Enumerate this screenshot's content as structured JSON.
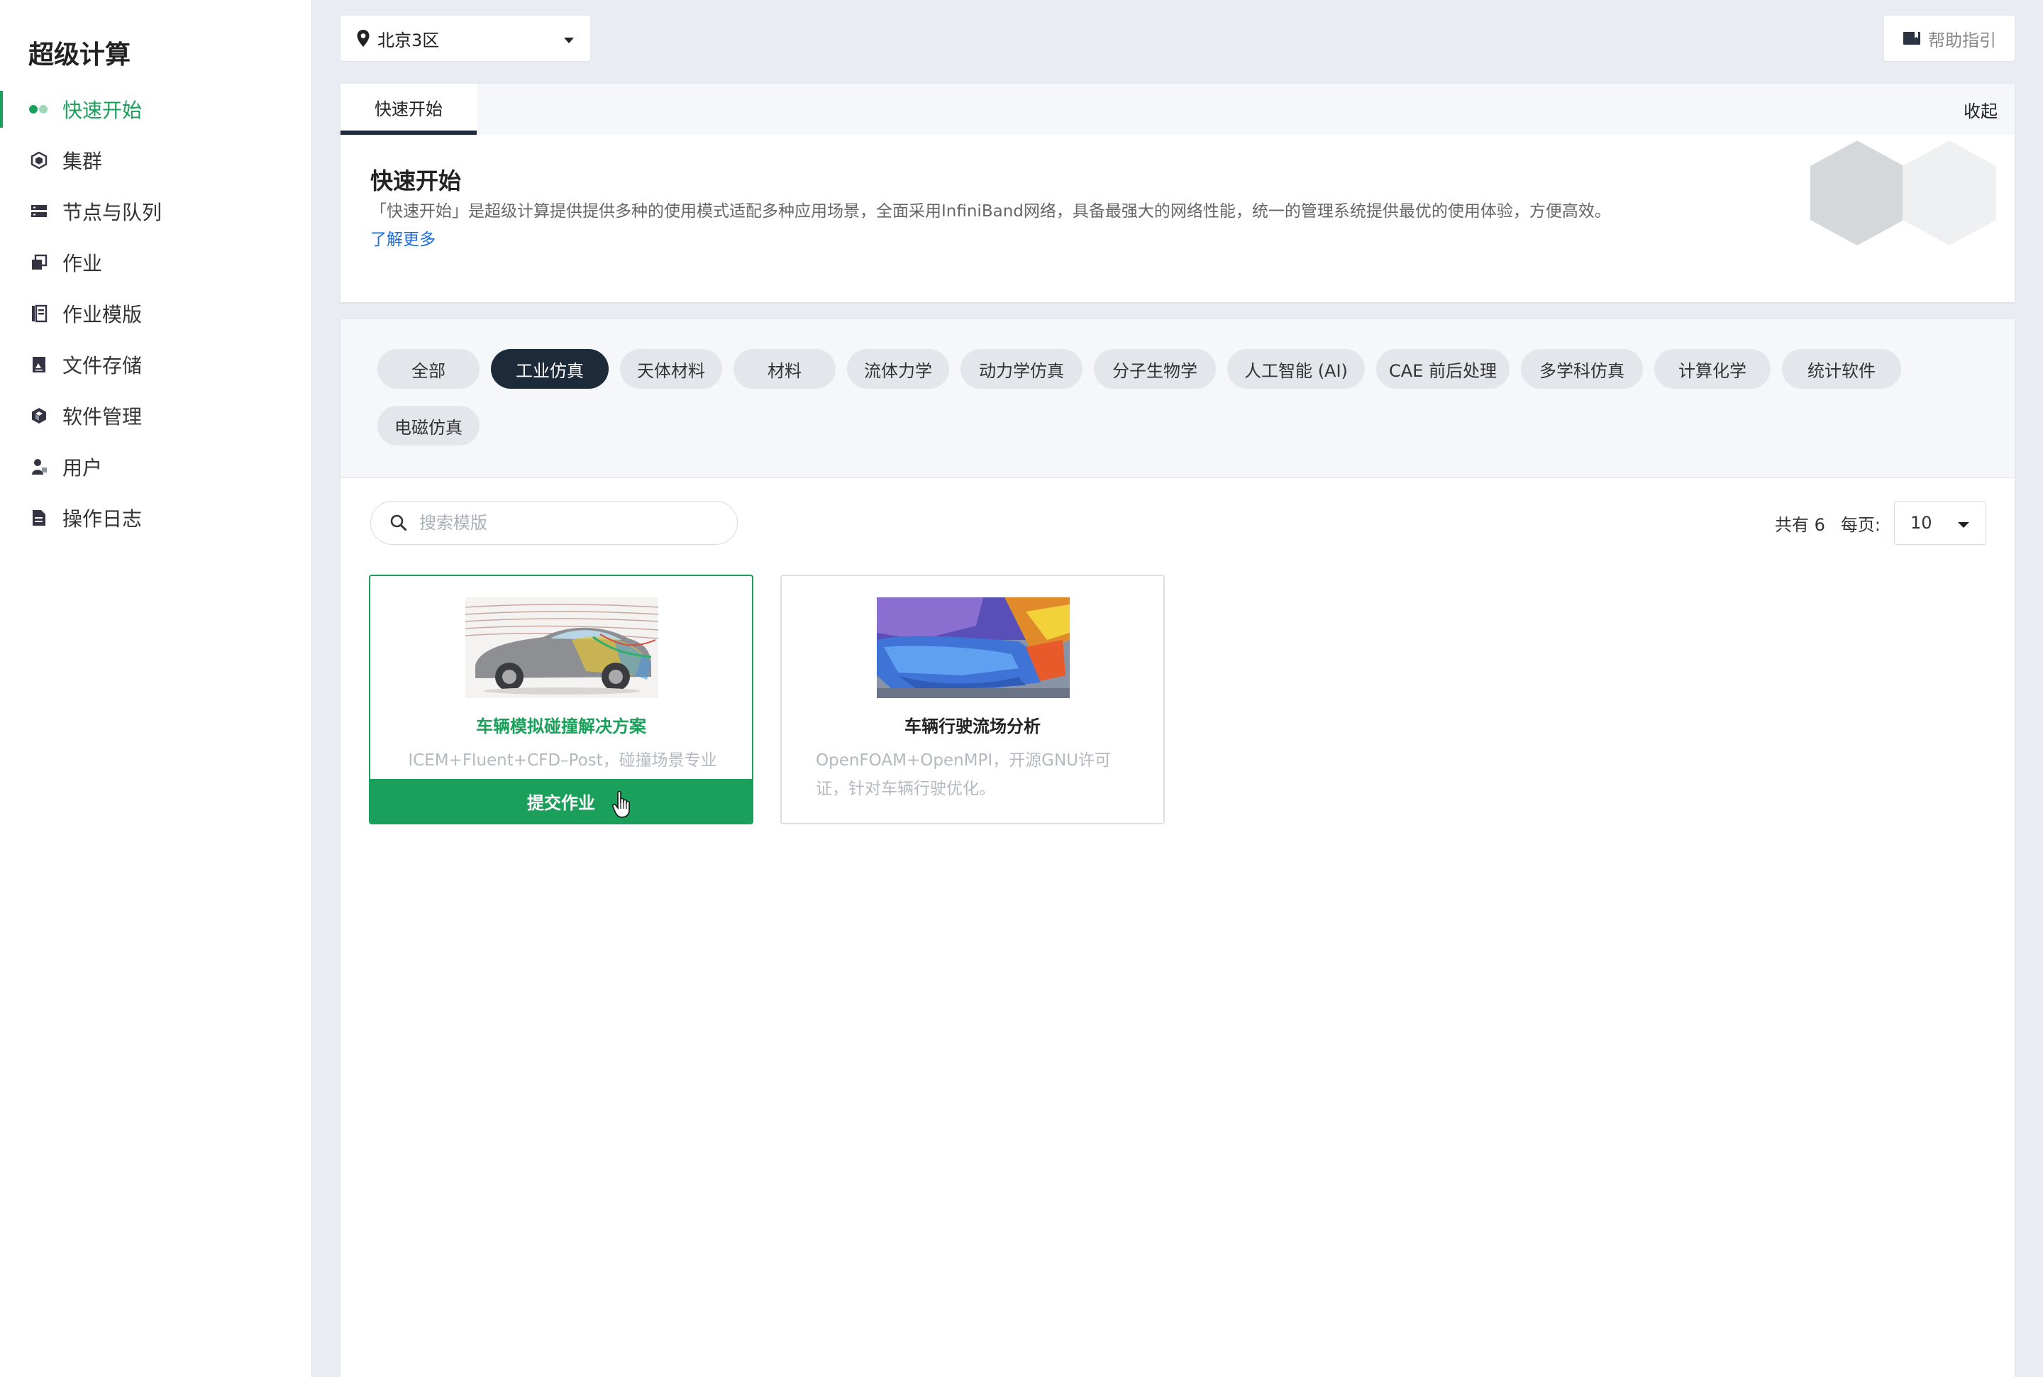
{
  "sidebar": {
    "title": "超级计算",
    "items": [
      {
        "label": "快速开始",
        "icon": "dots-icon"
      },
      {
        "label": "集群",
        "icon": "cube-icon"
      },
      {
        "label": "节点与队列",
        "icon": "server-icon"
      },
      {
        "label": "作业",
        "icon": "job-icon"
      },
      {
        "label": "作业模版",
        "icon": "template-icon"
      },
      {
        "label": "文件存储",
        "icon": "storage-icon"
      },
      {
        "label": "软件管理",
        "icon": "package-icon"
      },
      {
        "label": "用户",
        "icon": "user-icon"
      },
      {
        "label": "操作日志",
        "icon": "log-icon"
      }
    ]
  },
  "topbar": {
    "region": "北京3区",
    "help_label": "帮助指引"
  },
  "intro": {
    "tab_label": "快速开始",
    "collapse_label": "收起",
    "title": "快速开始",
    "description": "「快速开始」是超级计算提供提供多种的使用模式适配多种应用场景，全面采用InfiniBand网络，具备最强大的网络性能，统一的管理系统提供最优的使用体验，方便高效。",
    "link_label": "了解更多"
  },
  "filters": [
    "全部",
    "工业仿真",
    "天体材料",
    "材料",
    "流体力学",
    "动力学仿真",
    "分子生物学",
    "人工智能 (AI)",
    "CAE 前后处理",
    "多学科仿真",
    "计算化学",
    "统计软件",
    "电磁仿真"
  ],
  "active_filter": "工业仿真",
  "search": {
    "placeholder": "搜索模版"
  },
  "pagination": {
    "total_label": "共有 6",
    "per_page_label": "每页:",
    "per_page_value": "10"
  },
  "cards": [
    {
      "title": "车辆模拟碰撞解决方案",
      "description": "ICEM+Fluent+CFD–Post，碰撞场景专业",
      "action_label": "提交作业"
    },
    {
      "title": "车辆行驶流场分析",
      "description": "OpenFOAM+OpenMPI，开源GNU许可证，针对车辆行驶优化。"
    }
  ],
  "colors": {
    "accent": "#1aa05a",
    "dark_chip": "#1d2a3a",
    "link": "#1b6bd8"
  }
}
